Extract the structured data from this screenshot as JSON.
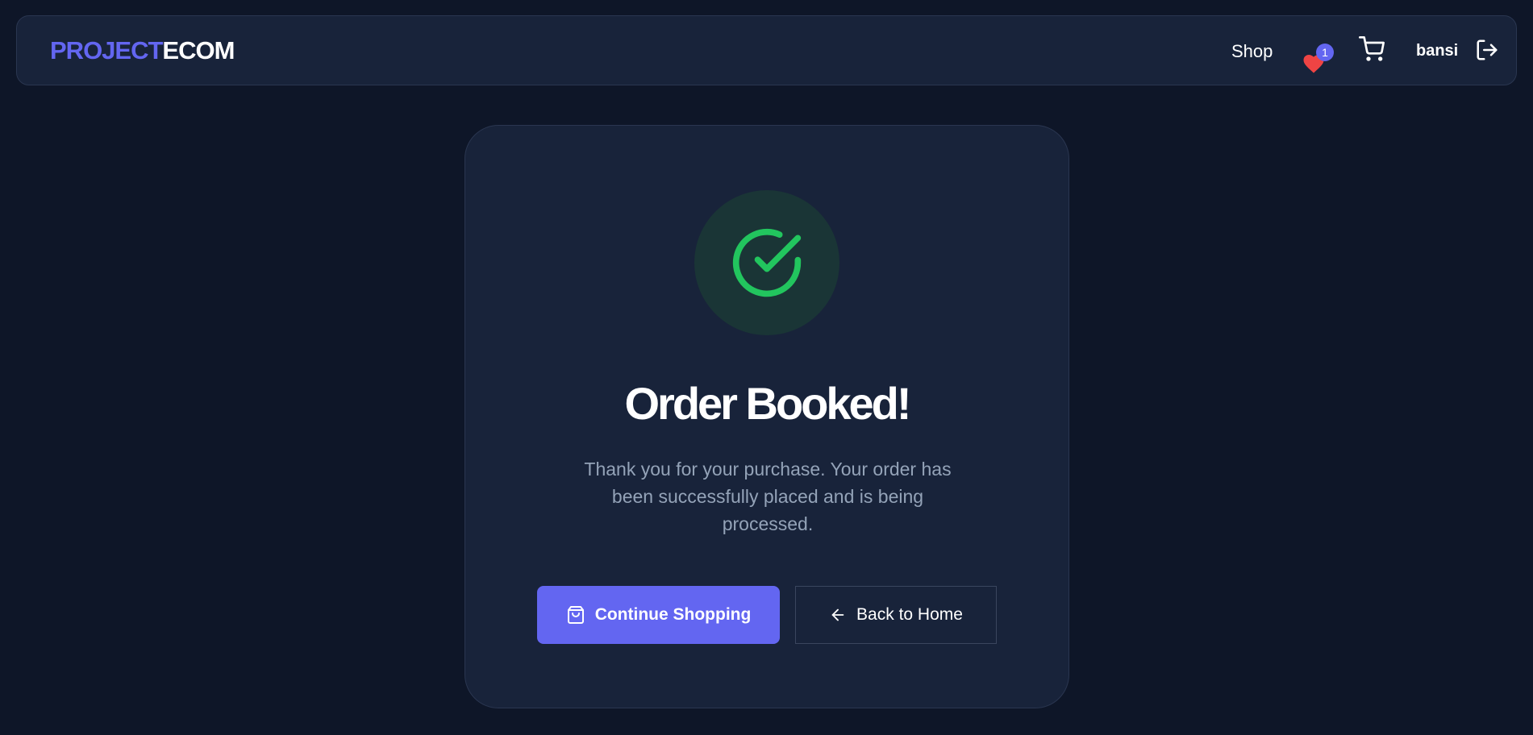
{
  "navbar": {
    "logo_part_a": "PROJECT",
    "logo_part_b": "ECOM",
    "shop_label": "Shop",
    "wishlist_count": "1",
    "username": "bansi",
    "icons": {
      "wishlist": "heart-icon",
      "cart": "cart-icon",
      "logout": "logout-icon"
    }
  },
  "card": {
    "status_icon": "check-circle-icon",
    "title": "Order Booked!",
    "message": "Thank you for your purchase. Your order has been successfully placed and is being processed.",
    "primary_button_label": "Continue Shopping",
    "primary_button_icon": "shopping-bag-icon",
    "secondary_button_label": "Back to Home",
    "secondary_button_icon": "arrow-left-icon"
  },
  "colors": {
    "background": "#0e1628",
    "surface": "#18233a",
    "accent": "#6366f1",
    "success": "#22c55e",
    "heart": "#ef4444",
    "muted_text": "#94a3b8"
  }
}
